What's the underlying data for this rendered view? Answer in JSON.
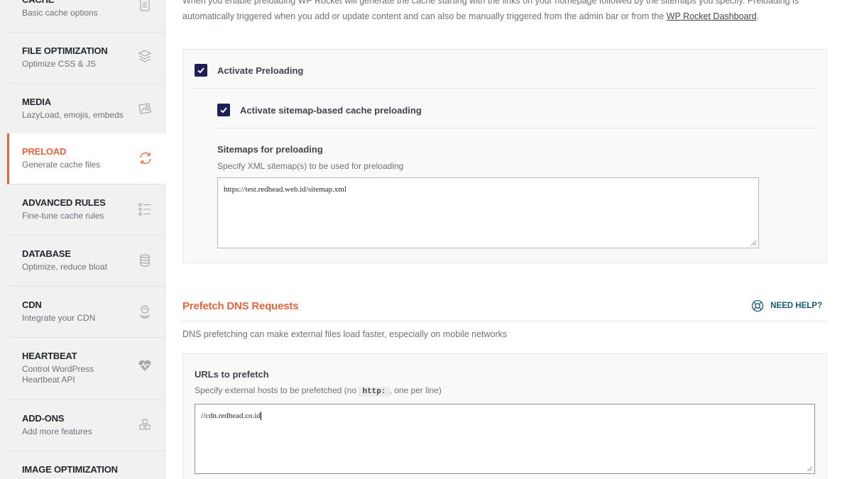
{
  "sidebar": {
    "items": [
      {
        "title": "CACHE",
        "sub": "Basic cache options",
        "icon": "document-icon"
      },
      {
        "title": "FILE OPTIMIZATION",
        "sub": "Optimize CSS & JS",
        "icon": "layers-icon"
      },
      {
        "title": "MEDIA",
        "sub": "LazyLoad, emojis, embeds",
        "icon": "image-icon"
      },
      {
        "title": "PRELOAD",
        "sub": "Generate cache files",
        "icon": "refresh-icon"
      },
      {
        "title": "ADVANCED RULES",
        "sub": "Fine-tune cache rules",
        "icon": "list-icon"
      },
      {
        "title": "DATABASE",
        "sub": "Optimize, reduce bloat",
        "icon": "database-icon"
      },
      {
        "title": "CDN",
        "sub": "Integrate your CDN",
        "icon": "cdn-icon"
      },
      {
        "title": "HEARTBEAT",
        "sub": "Control WordPress Heartbeat API",
        "icon": "heartbeat-icon"
      },
      {
        "title": "ADD-ONS",
        "sub": "Add more features",
        "icon": "cubes-icon"
      },
      {
        "title": "IMAGE OPTIMIZATION",
        "sub": "",
        "icon": "image-optimization-icon"
      }
    ],
    "active": "PRELOAD"
  },
  "preload": {
    "intro_text": "When you enable preloading WP Rocket will generate the cache starting with the links on your homepage followed by the sitemaps you specify. Preloading is automatically triggered when you add or update content and can also be manually triggered from the admin bar or from the",
    "intro_link": "WP Rocket Dashboard",
    "intro_end": ".",
    "activate_label": "Activate Preloading",
    "sitemap_label": "Activate sitemap-based cache preloading",
    "sitemaps_title": "Sitemaps for preloading",
    "sitemaps_desc": "Specify XML sitemap(s) to be used for preloading",
    "sitemaps_value": "https://test.redhead.web.id/sitemap.xml"
  },
  "prefetch": {
    "title": "Prefetch DNS Requests",
    "help_label": "NEED HELP?",
    "desc": "DNS prefetching can make external files load faster, especially on mobile networks",
    "urls_title": "URLs to prefetch",
    "urls_desc_before": "Specify external hosts to be prefetched (no",
    "urls_desc_code": "http:",
    "urls_desc_after": ", one per line)",
    "urls_value": "//cdn.redhead.co.id"
  },
  "colors": {
    "accent": "#e26540",
    "checkbox": "#1e1e58",
    "help": "#1a5a73"
  }
}
